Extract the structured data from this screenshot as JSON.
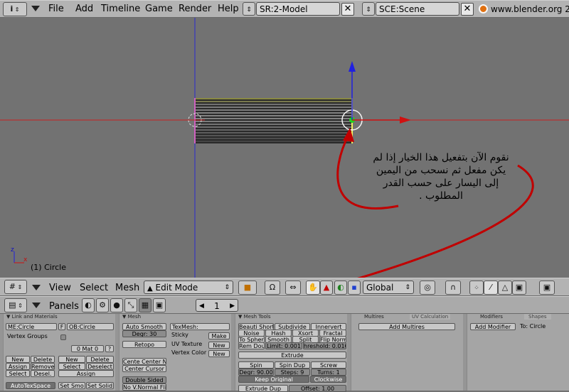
{
  "top_menu": {
    "items": [
      "File",
      "Add",
      "Timeline",
      "Game",
      "Render",
      "Help"
    ],
    "screen_field": "SR:2-Model",
    "scene_field": "SCE:Scene",
    "website": "www.blender.org 2"
  },
  "viewport": {
    "frame_label": "(1) Circle",
    "axis_x": "x",
    "axis_z": "z",
    "annotation_lines": [
      "نقوم الآن بتفعيل هذا الخيار إذا لم",
      "يكن مفعل ثم نسحب من اليمين",
      "إلى اليسار على حسب القدر",
      "المطلوب ."
    ]
  },
  "view_header": {
    "menus": [
      "View",
      "Select",
      "Mesh"
    ],
    "mode": "Edit Mode",
    "orientation": "Global"
  },
  "buttons_header": {
    "label": "Panels",
    "counter": "1"
  },
  "panels": {
    "link_materials": {
      "title": "Link and Materials",
      "me_field": "ME:Circle",
      "f_label": "F",
      "ob_field": "OB:Circle",
      "vertex_groups": "Vertex Groups",
      "mat_field": "0 Mat 0",
      "question": "?",
      "btn_new1": "New",
      "btn_delete1": "Delete",
      "btn_new2": "New",
      "btn_delete2": "Delete",
      "btn_assign1": "Assign",
      "btn_remove": "Remove",
      "btn_select1": "Select",
      "btn_deselect1": "Deselect",
      "btn_select2": "Select",
      "btn_desel": "Desel.",
      "btn_assign2": "Assign",
      "btn_autotex": "AutoTexSpace",
      "btn_setsmo": "Set Smo",
      "btn_setsolid": "Set Solid"
    },
    "mesh": {
      "title": "Mesh",
      "auto_smooth": "Auto Smooth",
      "degr": "Degr: 30",
      "retopo": "Retopo",
      "center_new": "Cente Center Ne",
      "center_cursor": "Center Cursor",
      "double_sided": "Double Sided",
      "no_vnormal": "No V.Normal Fli",
      "texmesh": "TexMesh:",
      "sticky": "Sticky",
      "make": "Make",
      "uv_texture": "UV Texture",
      "new1": "New",
      "vertex_color": "Vertex Color",
      "new2": "New"
    },
    "mesh_tools": {
      "title": "Mesh Tools",
      "beauty_short": "Beauti Short",
      "subdivide": "Subdivide",
      "innervert": "Innervert",
      "noise": "Noise",
      "hash": "Hash",
      "xsort": "Xsort",
      "fractal": "Fractal",
      "to_sphere": "To Spher",
      "smooth": "Smooth",
      "split": "Split",
      "flip_norm": "Flip Norm",
      "rem_doub": "Rem Dou",
      "limit": "Limit: 0.001",
      "threshold": "hreshold: 0.010",
      "extrude": "Extrude",
      "spin": "Spin",
      "spin_dup": "Spin Dup",
      "screw": "Screw",
      "degr": "Degr: 90.00",
      "steps": "Steps: 9",
      "turns": "Turns: 1",
      "keep_original": "Keep Original",
      "clockwise": "Clockwise",
      "extrude_dup": "Extrude Dup",
      "offset": "Offset: 1.00"
    },
    "multires": {
      "title": "Multires",
      "tab2": "UV Calculation",
      "add": "Add Multires"
    },
    "modifiers": {
      "title": "Modifiers",
      "tab2": "Shapes",
      "add": "Add Modifier",
      "to": "To: Circle"
    }
  },
  "colors": {
    "viewport_bg": "#727272",
    "header_bg": "#b3b3b3",
    "mesh_yellow": "#e0e060",
    "axis_red": "#d00000",
    "axis_blue": "#1010e0",
    "arrow_red": "#c00000"
  }
}
